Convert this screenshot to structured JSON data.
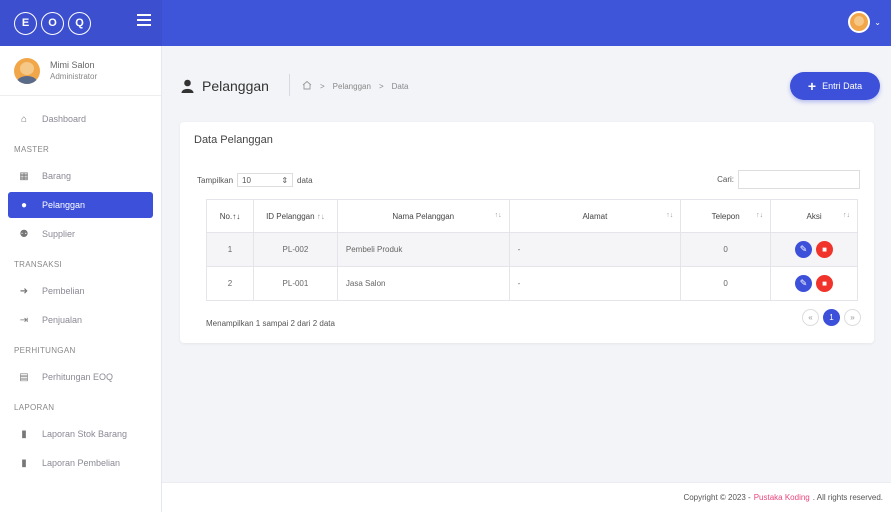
{
  "brand": {
    "letters": [
      "E",
      "O",
      "Q"
    ]
  },
  "user": {
    "name": "Mimi Salon",
    "role": "Administrator"
  },
  "sidebar": {
    "dashboard": "Dashboard",
    "sections": {
      "master": "MASTER",
      "transaksi": "TRANSAKSI",
      "perhitungan": "PERHITUNGAN",
      "laporan": "LAPORAN"
    },
    "master_items": [
      {
        "label": "Barang",
        "icon": "box-icon"
      },
      {
        "label": "Pelanggan",
        "icon": "user-icon"
      },
      {
        "label": "Supplier",
        "icon": "users-icon"
      }
    ],
    "transaksi_items": [
      {
        "label": "Pembelian",
        "icon": "sign-in-icon"
      },
      {
        "label": "Penjualan",
        "icon": "sign-out-icon"
      }
    ],
    "perhitungan_items": [
      {
        "label": "Perhitungan EOQ",
        "icon": "calculator-icon"
      }
    ],
    "laporan_items": [
      {
        "label": "Laporan Stok Barang",
        "icon": "file-icon"
      },
      {
        "label": "Laporan Pembelian",
        "icon": "file-import-icon"
      }
    ]
  },
  "header": {
    "title": "Pelanggan",
    "breadcrumb": [
      "Pelanggan",
      "Data"
    ],
    "entri_button": "Entri Data"
  },
  "card": {
    "title": "Data Pelanggan",
    "show_prefix": "Tampilkan",
    "show_value": "10",
    "show_suffix": "data",
    "search_label": "Cari:",
    "columns": [
      "No.",
      "ID Pelanggan",
      "Nama Pelanggan",
      "Alamat",
      "Telepon",
      "Aksi"
    ],
    "rows": [
      {
        "no": "1",
        "id": "PL-002",
        "nama": "Pembeli Produk",
        "alamat": "-",
        "telepon": "0"
      },
      {
        "no": "2",
        "id": "PL-001",
        "nama": "Jasa Salon",
        "alamat": "-",
        "telepon": "0"
      }
    ],
    "info": "Menampilkan 1 sampai 2 dari 2 data",
    "pager": {
      "prev": "«",
      "current": "1",
      "next": "»"
    }
  },
  "footer": {
    "prefix": "Copyright © 2023 -",
    "brand": "Pustaka Koding",
    "suffix": ". All rights reserved."
  },
  "colors": {
    "primary": "#3c50d9",
    "danger": "#f0342b",
    "footer_brand": "#e8467b"
  }
}
